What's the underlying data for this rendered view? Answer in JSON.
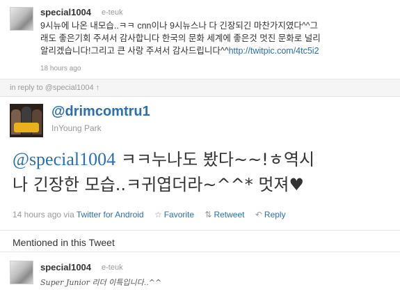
{
  "top_tweet": {
    "username": "special1004",
    "fullname": "e-teuk",
    "text_lines": [
      "9시뉴에 나온 내모습..ㅋㅋ cnn이나 9시뉴스나 다 긴장되긴 마찬가지였다^^그",
      "래도 좋은기회 주셔서 감사합니다 한국의 문화 세계에 좋은것 멋진 문화로 널리",
      "알리겠습니다!그리고 큰 사랑 주셔서 감사드립니다^^"
    ],
    "link": "http://twitpic.com/4tc5i2",
    "time": "18 hours ago"
  },
  "reply_bar": {
    "text": "in reply to @special1004 ↑"
  },
  "main_tweet": {
    "handle": "@drimcomtru1",
    "fullname": "InYoung Park",
    "mention": "@special1004",
    "text_line1": " ㅋㅋ누나도 봤다~~!ㅎ역시",
    "text_line2": "나 긴장한 모습..ㅋ귀엽더라~^^* 멋져♥",
    "time": "14 hours ago",
    "via_prefix": "via",
    "via_app": "Twitter for Android",
    "actions": {
      "favorite": "Favorite",
      "retweet": "Retweet",
      "reply": "Reply"
    }
  },
  "mentioned": {
    "heading": "Mentioned in this Tweet"
  },
  "mentioned_user": {
    "username": "special1004",
    "fullname": "e-teuk",
    "bio": "Super Junior 리더 이특입니다..^^"
  },
  "colors": {
    "link": "#2a6fb0",
    "muted": "#999999",
    "text": "#333333"
  }
}
